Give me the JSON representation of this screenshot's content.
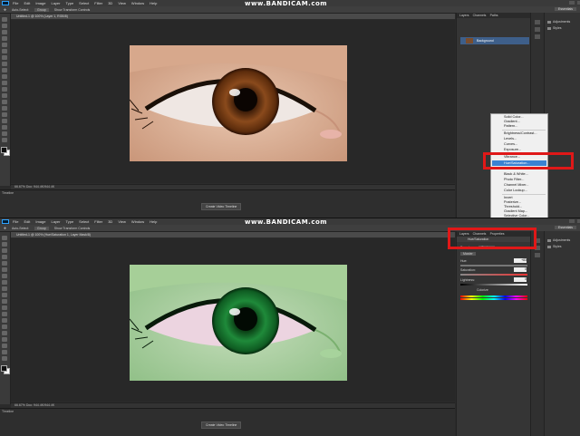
{
  "watermark": "www.BANDICAM.com",
  "menu": [
    "File",
    "Edit",
    "Image",
    "Layer",
    "Type",
    "Select",
    "Filter",
    "3D",
    "View",
    "Window",
    "Help"
  ],
  "options_bar": {
    "auto_select": "Auto-Select:",
    "layer_select": "Group",
    "show_transform": "Show Transform Controls"
  },
  "workspace": "Essentials",
  "top": {
    "doc_tab": "Untitled-1 @ 100% (Layer 1, RGB/8)",
    "status": "66.67%   Doc: 944.4K/944.4K",
    "timeline_label": "Timeline",
    "timeline_button": "Create Video Timeline",
    "panel_tabs": [
      "Layers",
      "Channels",
      "Paths"
    ],
    "layer_name": "Background",
    "far_panel": [
      "Adjustments",
      "Styles"
    ],
    "adjustment_menu": {
      "items": [
        "Solid Color...",
        "Gradient...",
        "Pattern...",
        "Brightness/Contrast...",
        "Levels...",
        "Curves...",
        "Exposure...",
        "Vibrance...",
        "Hue/Saturation...",
        "Color Balance...",
        "Black & White...",
        "Photo Filter...",
        "Channel Mixer...",
        "Color Lookup...",
        "Invert",
        "Posterize...",
        "Threshold...",
        "Gradient Map...",
        "Selective Color..."
      ],
      "selected": "Hue/Saturation..."
    }
  },
  "bottom": {
    "doc_tab": "Untitled-1 @ 100% (Hue/Saturation 1, Layer Mask/8)",
    "status": "66.67%   Doc: 944.4K/944.4K",
    "timeline_label": "Timeline",
    "timeline_button": "Create Video Timeline",
    "panel_tabs": [
      "Layers",
      "Channels",
      "Properties"
    ],
    "properties_title": "Hue/Saturation",
    "preset_label": "Preset:",
    "preset_value": "Custom",
    "channel": "Master",
    "hue_label": "Hue:",
    "hue_value": "+83",
    "saturation_label": "Saturation:",
    "saturation_value": "0",
    "lightness_label": "Lightness:",
    "lightness_value": "0",
    "colorize_label": "Colorize",
    "far_panel": [
      "Adjustments",
      "Styles"
    ]
  },
  "colors": {
    "highlight_box": "#e01818",
    "menu_selection": "#3a82d2"
  }
}
